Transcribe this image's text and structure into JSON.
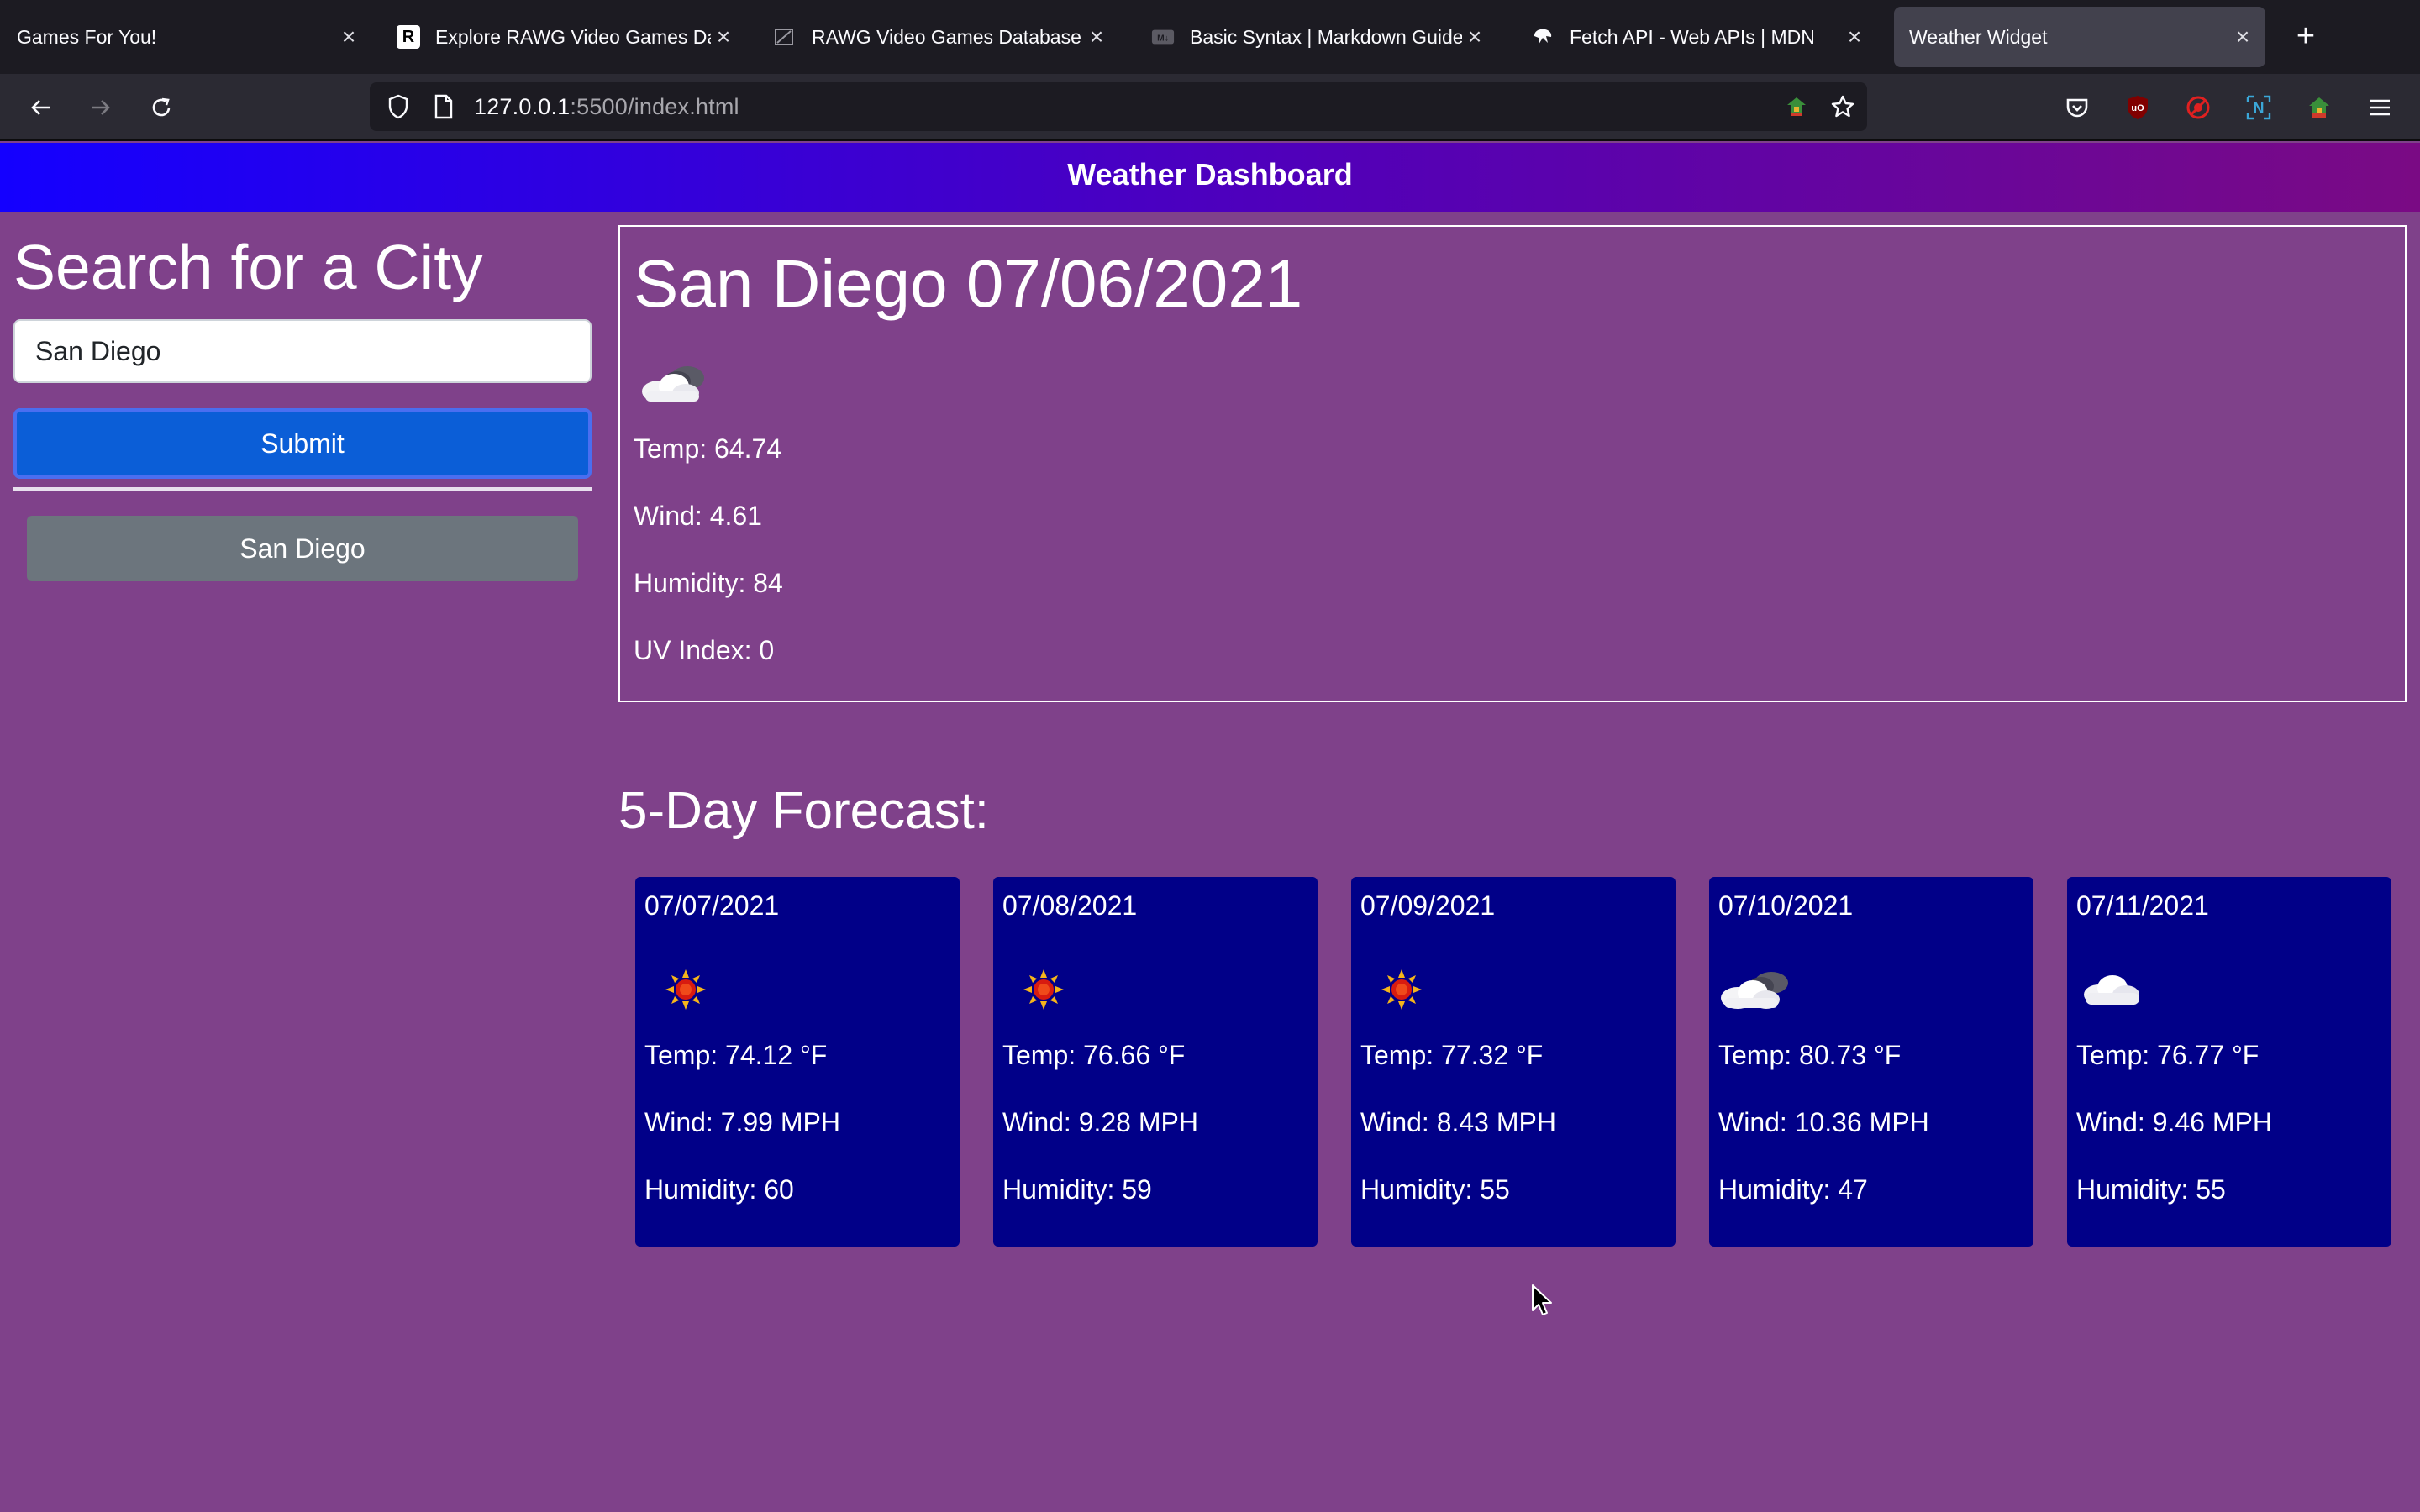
{
  "browser": {
    "tabs": [
      {
        "title": "Games For You!",
        "favicon": "none",
        "active": false
      },
      {
        "title": "Explore RAWG Video Games Database",
        "favicon": "rawg-logo-icon",
        "active": false
      },
      {
        "title": "RAWG Video Games Database API",
        "favicon": "rawg-api-icon",
        "active": false
      },
      {
        "title": "Basic Syntax | Markdown Guide",
        "favicon": "markdown-icon",
        "active": false
      },
      {
        "title": "Fetch API - Web APIs | MDN",
        "favicon": "mdn-dino-icon",
        "active": false
      },
      {
        "title": "Weather Widget",
        "favicon": "none",
        "active": true
      }
    ],
    "url_host": "127.0.0.1",
    "url_rest": ":5500/index.html",
    "toolbar_icons": [
      "back-icon",
      "forward-icon",
      "reload-icon",
      "shield-icon",
      "page-icon",
      "extension-icon",
      "bookmark-star-icon",
      "pocket-icon",
      "ublock-icon",
      "blocker-icon",
      "extension-n-icon",
      "extension-colorful-icon",
      "hamburger-menu-icon"
    ]
  },
  "header": {
    "title": "Weather Dashboard"
  },
  "sidebar": {
    "heading": "Search for a City",
    "input_value": "San Diego",
    "submit_label": "Submit",
    "history": [
      "San Diego"
    ]
  },
  "current": {
    "title": "San Diego 07/06/2021",
    "icon": "cloudy-night-icon",
    "temp": "Temp: 64.74",
    "wind": "Wind: 4.61",
    "humidity": "Humidity: 84",
    "uv": "UV Index: 0"
  },
  "forecast": {
    "title": "5-Day Forecast:",
    "days": [
      {
        "date": "07/07/2021",
        "icon": "sun-icon",
        "temp": "Temp: 74.12 °F",
        "wind": "Wind: 7.99 MPH",
        "humidity": "Humidity: 60"
      },
      {
        "date": "07/08/2021",
        "icon": "sun-icon",
        "temp": "Temp: 76.66 °F",
        "wind": "Wind: 9.28 MPH",
        "humidity": "Humidity: 59"
      },
      {
        "date": "07/09/2021",
        "icon": "sun-icon",
        "temp": "Temp: 77.32 °F",
        "wind": "Wind: 8.43 MPH",
        "humidity": "Humidity: 55"
      },
      {
        "date": "07/10/2021",
        "icon": "cloudy-night-icon",
        "temp": "Temp: 80.73 °F",
        "wind": "Wind: 10.36 MPH",
        "humidity": "Humidity: 47"
      },
      {
        "date": "07/11/2021",
        "icon": "cloud-icon",
        "temp": "Temp: 76.77 °F",
        "wind": "Wind: 9.46 MPH",
        "humidity": "Humidity: 55"
      }
    ]
  },
  "colors": {
    "page_bg": "#7f418a",
    "card_bg": "#010088",
    "submit_bg": "#0b5ed7",
    "history_bg": "#6c757d",
    "header_gradient_start": "#1400ff",
    "header_gradient_end": "#7a0a84"
  }
}
